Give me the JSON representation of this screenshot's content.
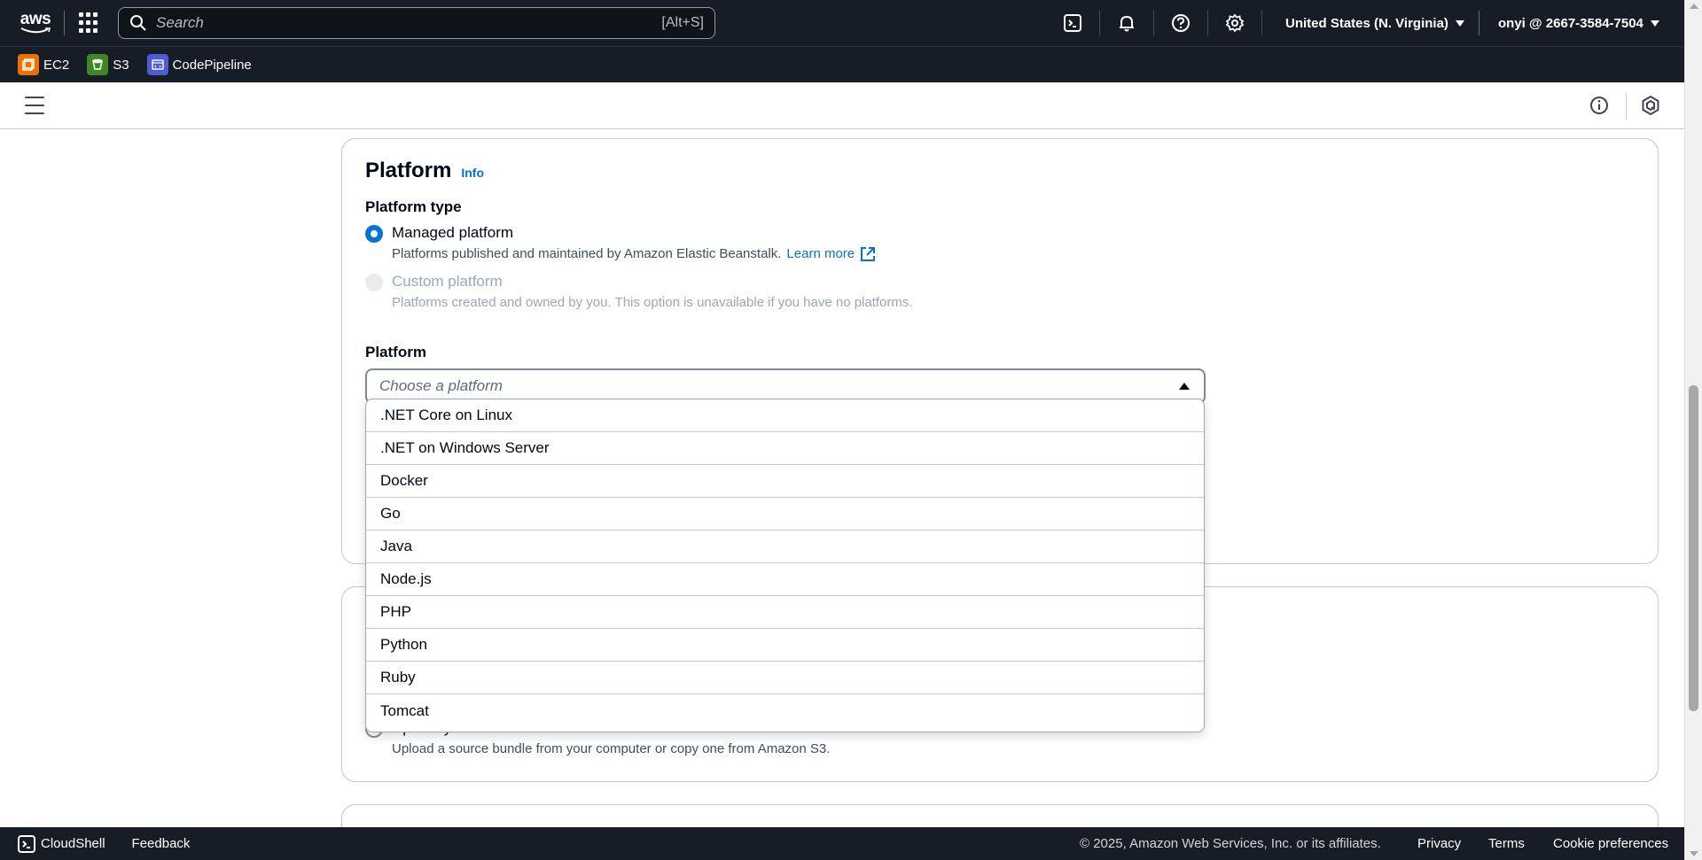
{
  "topnav": {
    "logo_text": "aws",
    "search_placeholder": "Search",
    "search_shortcut": "[Alt+S]",
    "region": "United States (N. Virginia)",
    "account": "onyi @ 2667-3584-7504",
    "icons": [
      "cloudshell-icon",
      "bell-icon",
      "help-icon",
      "settings-icon"
    ]
  },
  "favorites": [
    {
      "label": "EC2",
      "color": "#ed7100"
    },
    {
      "label": "S3",
      "color": "#3f8624"
    },
    {
      "label": "CodePipeline",
      "color": "#4d5bd9"
    }
  ],
  "platform_section": {
    "title": "Platform",
    "info": "Info",
    "type_label": "Platform type",
    "managed": {
      "label": "Managed platform",
      "description": "Platforms published and maintained by Amazon Elastic Beanstalk.",
      "learn_more": "Learn more",
      "selected": true
    },
    "custom": {
      "label": "Custom platform",
      "description": "Platforms created and owned by you. This option is unavailable if you have no platforms.",
      "disabled": true
    },
    "platform_label": "Platform",
    "select_placeholder": "Choose a platform",
    "options": [
      ".NET Core on Linux",
      ".NET on Windows Server",
      "Docker",
      "Go",
      "Java",
      "Node.js",
      "PHP",
      "Python",
      "Ruby",
      "Tomcat"
    ]
  },
  "code_section": {
    "upload_label": "Upload your code",
    "upload_description": "Upload a source bundle from your computer or copy one from Amazon S3."
  },
  "footer": {
    "cloudshell": "CloudShell",
    "feedback": "Feedback",
    "copyright": "© 2025, Amazon Web Services, Inc. or its affiliates.",
    "privacy": "Privacy",
    "terms": "Terms",
    "cookie": "Cookie preferences"
  }
}
